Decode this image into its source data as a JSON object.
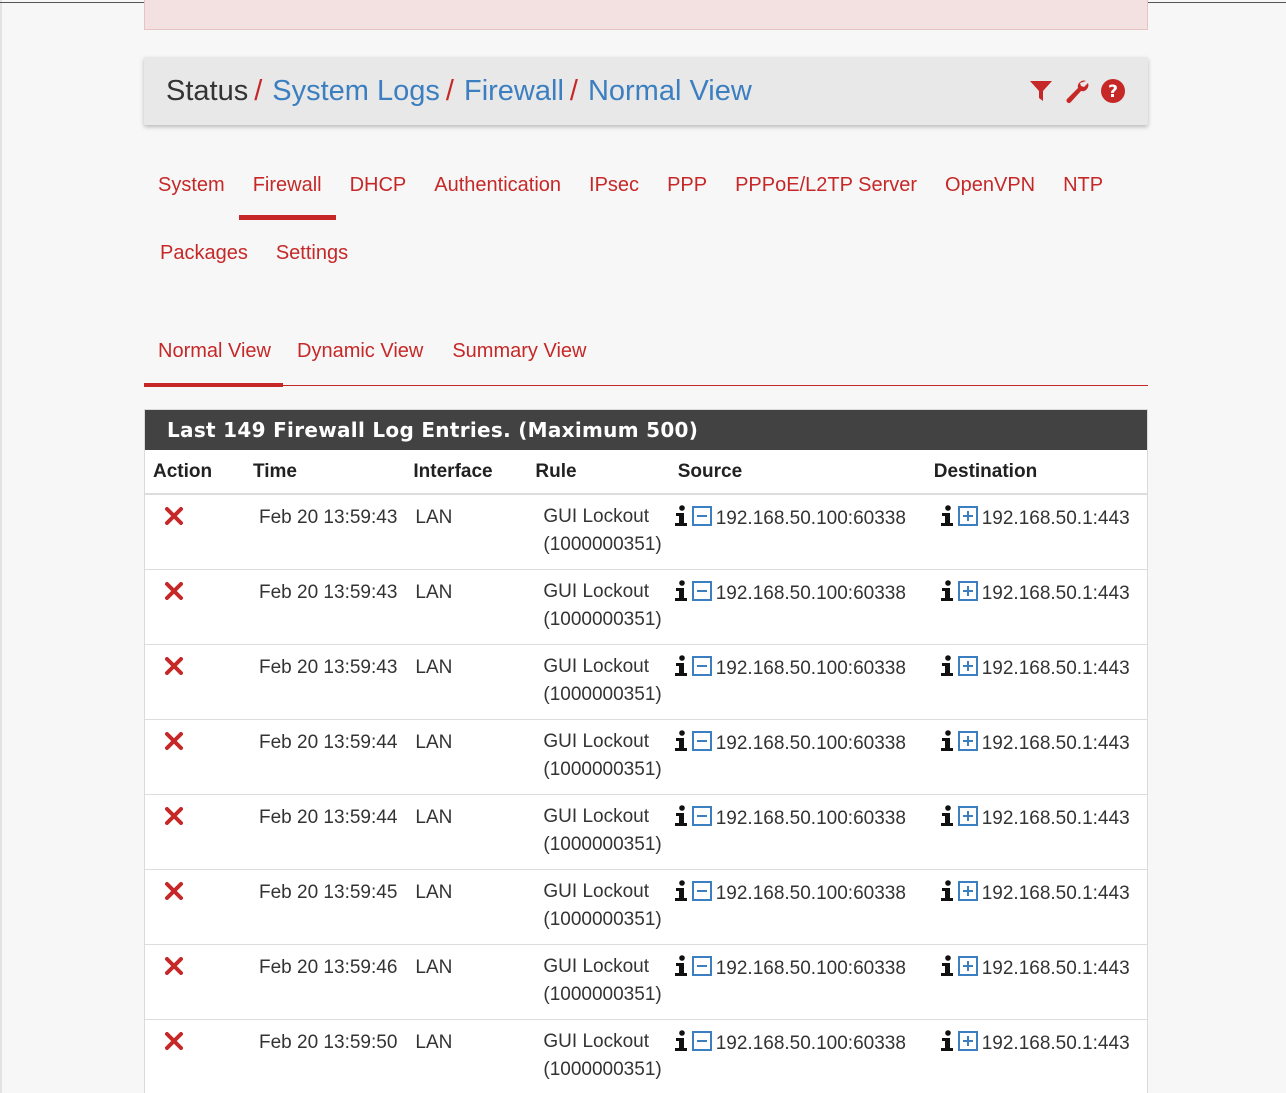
{
  "breadcrumb": {
    "items": [
      {
        "label": "Status",
        "link": false
      },
      {
        "label": "System Logs",
        "link": true
      },
      {
        "label": "Firewall",
        "link": true
      },
      {
        "label": "Normal View",
        "link": true
      }
    ],
    "separator": "/",
    "icons": [
      "filter-icon",
      "wrench-icon",
      "help-icon"
    ]
  },
  "primary_tabs": {
    "row1": [
      "System",
      "Firewall",
      "DHCP",
      "Authentication",
      "IPsec",
      "PPP",
      "PPPoE/L2TP Server",
      "OpenVPN",
      "NTP"
    ],
    "row2": [
      "Packages",
      "Settings"
    ],
    "active": "Firewall"
  },
  "view_tabs": {
    "items": [
      "Normal View",
      "Dynamic View",
      "Summary View"
    ],
    "active": "Normal View"
  },
  "panel": {
    "title": "Last 149 Firewall Log Entries. (Maximum 500)",
    "columns": [
      "Action",
      "Time",
      "Interface",
      "Rule",
      "Source",
      "Destination"
    ]
  },
  "rows": [
    {
      "action": "block",
      "time": "Feb 20 13:59:43",
      "interface": "LAN",
      "rule_name": "GUI Lockout",
      "rule_id": "(1000000351)",
      "source": "192.168.50.100:60338",
      "destination": "192.168.50.1:443"
    },
    {
      "action": "block",
      "time": "Feb 20 13:59:43",
      "interface": "LAN",
      "rule_name": "GUI Lockout",
      "rule_id": "(1000000351)",
      "source": "192.168.50.100:60338",
      "destination": "192.168.50.1:443"
    },
    {
      "action": "block",
      "time": "Feb 20 13:59:43",
      "interface": "LAN",
      "rule_name": "GUI Lockout",
      "rule_id": "(1000000351)",
      "source": "192.168.50.100:60338",
      "destination": "192.168.50.1:443"
    },
    {
      "action": "block",
      "time": "Feb 20 13:59:44",
      "interface": "LAN",
      "rule_name": "GUI Lockout",
      "rule_id": "(1000000351)",
      "source": "192.168.50.100:60338",
      "destination": "192.168.50.1:443"
    },
    {
      "action": "block",
      "time": "Feb 20 13:59:44",
      "interface": "LAN",
      "rule_name": "GUI Lockout",
      "rule_id": "(1000000351)",
      "source": "192.168.50.100:60338",
      "destination": "192.168.50.1:443"
    },
    {
      "action": "block",
      "time": "Feb 20 13:59:45",
      "interface": "LAN",
      "rule_name": "GUI Lockout",
      "rule_id": "(1000000351)",
      "source": "192.168.50.100:60338",
      "destination": "192.168.50.1:443"
    },
    {
      "action": "block",
      "time": "Feb 20 13:59:46",
      "interface": "LAN",
      "rule_name": "GUI Lockout",
      "rule_id": "(1000000351)",
      "source": "192.168.50.100:60338",
      "destination": "192.168.50.1:443"
    },
    {
      "action": "block",
      "time": "Feb 20 13:59:50",
      "interface": "LAN",
      "rule_name": "GUI Lockout",
      "rule_id": "(1000000351)",
      "source": "192.168.50.100:60338",
      "destination": "192.168.50.1:443"
    }
  ],
  "colors": {
    "accent": "#c62828",
    "link": "#3c7fc1",
    "panel_header": "#424242",
    "icon_blue": "#3c7fc1"
  }
}
